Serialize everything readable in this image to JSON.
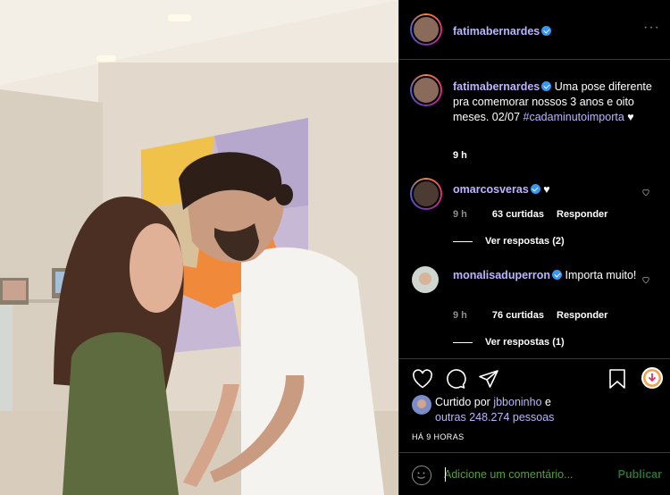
{
  "post": {
    "author": "fatimabernardes",
    "caption_text": " Uma pose diferente pra comemorar nossos 3 anos e oito meses. 02/07",
    "hashtag": "#cadaminutoimporta",
    "caption_heart": "♥",
    "time": "9 h",
    "more_label": "···"
  },
  "comments": [
    {
      "user": "omarcosveras",
      "text": " ♥",
      "time": "9 h",
      "likes": "63 curtidas",
      "reply": "Responder",
      "view_replies": "Ver respostas (2)"
    },
    {
      "user": "monalisaduperron",
      "text": " Importa muito!",
      "time": "9 h",
      "likes": "76 curtidas",
      "reply": "Responder",
      "view_replies": "Ver respostas (1)"
    }
  ],
  "likes_section": {
    "prefix": "Curtido por ",
    "liker": "jbboninho",
    "and": " e",
    "others": "outras 248.274 pessoas"
  },
  "posted_ago": "HÁ 9 HORAS",
  "comment_box": {
    "placeholder": "Adicione um comentário...",
    "publish": "Publicar"
  },
  "icons": [
    "heart-icon",
    "comment-icon",
    "share-icon",
    "bookmark-icon",
    "download-icon",
    "emoji-icon",
    "verified-icon",
    "more-icon"
  ],
  "colors": {
    "username": "#b9b5ff",
    "background": "#000000",
    "publish": "#2f6b35",
    "placeholder": "#5a9a45"
  }
}
